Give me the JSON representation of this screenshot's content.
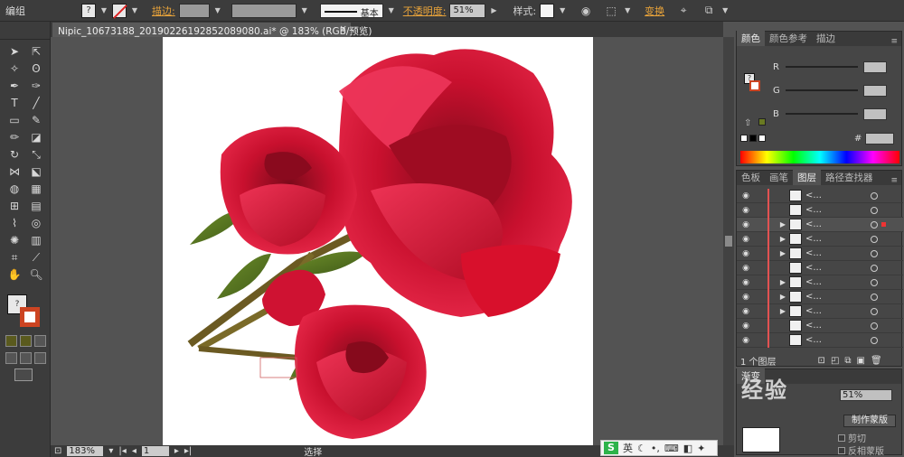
{
  "control_bar": {
    "group_label": "编组",
    "stroke_label": "描边:",
    "brush_label": "基本",
    "opacity_label": "不透明度:",
    "opacity_value": "51%",
    "style_label": "样式:",
    "transform_label": "变换",
    "fill_symbol": "?"
  },
  "document": {
    "tab_title": "Nipic_10673188_20190226192852089080.ai* @ 183% (RGB/预览)",
    "close_glyph": "×"
  },
  "status_bar": {
    "zoom": "183%",
    "page": "1",
    "selection_label": "选择"
  },
  "ime": {
    "logo": "S",
    "lang": "英"
  },
  "color_panel": {
    "tabs": [
      "颜色",
      "颜色参考",
      "描边"
    ],
    "channels": [
      {
        "label": "R"
      },
      {
        "label": "G"
      },
      {
        "label": "B"
      }
    ],
    "hex_label": "#",
    "fill_symbol": "?"
  },
  "layers_panel": {
    "tabs": [
      "色板",
      "画笔",
      "图层",
      "路径查找器"
    ],
    "rows": [
      {
        "name": "<..."
      },
      {
        "name": "<..."
      },
      {
        "name": "<..."
      },
      {
        "name": "<..."
      },
      {
        "name": "<..."
      },
      {
        "name": "<..."
      },
      {
        "name": "<..."
      },
      {
        "name": "<..."
      },
      {
        "name": "<..."
      },
      {
        "name": "<..."
      },
      {
        "name": "<..."
      }
    ],
    "footer": "1 个图层"
  },
  "transparency_panel": {
    "tab": "渐变",
    "opacity_value": "51%",
    "mask_button": "制作蒙版",
    "clip_label": "剪切",
    "invert_label": "反相蒙版"
  },
  "watermark": "经验"
}
